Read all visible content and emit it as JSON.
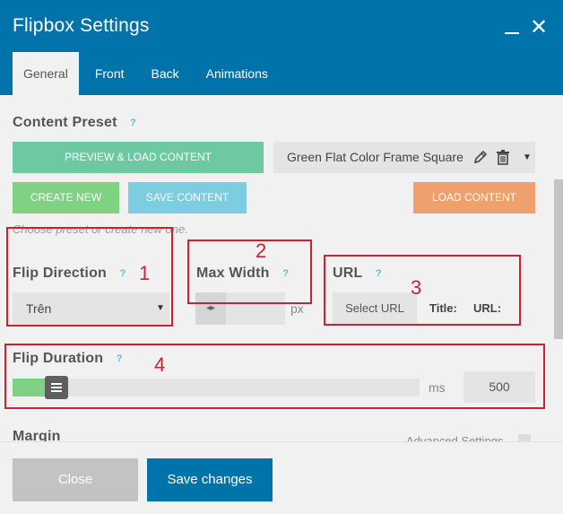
{
  "window": {
    "title": "Flipbox Settings",
    "minimize_icon": "minimize-icon",
    "close_icon": "close-icon"
  },
  "tabs": [
    {
      "label": "General",
      "active": true
    },
    {
      "label": "Front",
      "active": false
    },
    {
      "label": "Back",
      "active": false
    },
    {
      "label": "Animations",
      "active": false
    }
  ],
  "content_preset": {
    "label": "Content Preset",
    "help": "?",
    "preview_button": "PREVIEW & LOAD CONTENT",
    "selected_preset": "Green Flat Color Frame Square",
    "create_button": "CREATE NEW",
    "save_button": "SAVE CONTENT",
    "load_button": "LOAD CONTENT",
    "hint": "Choose preset or create new one."
  },
  "flip_direction": {
    "label": "Flip Direction",
    "help": "?",
    "value": "Trên",
    "marker": "1"
  },
  "max_width": {
    "label": "Max Width",
    "help": "?",
    "value": "",
    "unit": "px",
    "marker": "2"
  },
  "url": {
    "label": "URL",
    "help": "?",
    "select_button": "Select URL",
    "title_label": "Title:",
    "url_label": "URL:",
    "marker": "3"
  },
  "flip_duration": {
    "label": "Flip Duration",
    "help": "?",
    "unit": "ms",
    "value": "500",
    "slider_fraction": 0.08,
    "marker": "4"
  },
  "margin": {
    "label": "Margin",
    "advanced_label": "Advanced Settings"
  },
  "footer": {
    "close_button": "Close",
    "save_button": "Save changes"
  },
  "colors": {
    "header_bg": "#0073aa",
    "preview_button": "#6ec9a3",
    "create_button": "#7fd184",
    "save_content_button": "#7ccde0",
    "load_button": "#f0a06d",
    "annotation_red": "#d02030",
    "save_changes_button": "#0073aa",
    "close_button": "#c3c3c3"
  }
}
